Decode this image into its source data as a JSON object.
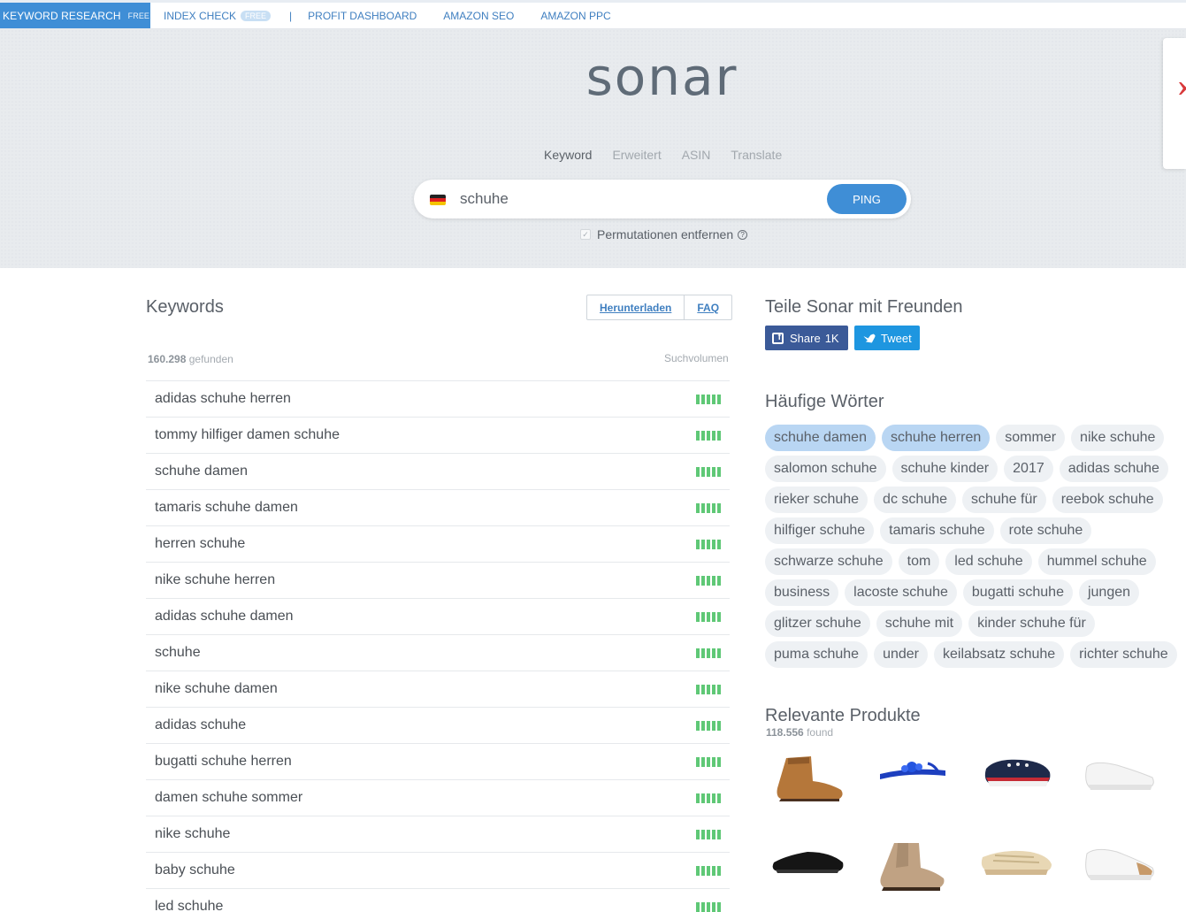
{
  "nav": {
    "active": {
      "label": "KEYWORD RESEARCH",
      "tag": "FREE"
    },
    "index_check": {
      "label": "INDEX CHECK",
      "tag": "FREE"
    },
    "separator": "|",
    "profit_dashboard": "PROFIT DASHBOARD",
    "amazon_seo": "AMAZON SEO",
    "amazon_ppc": "AMAZON PPC"
  },
  "hero": {
    "logo": "sonar",
    "modes": [
      "Keyword",
      "Erweitert",
      "ASIN",
      "Translate"
    ],
    "active_mode": "Keyword",
    "search_value": "schuhe",
    "ping_label": "PING",
    "permutations_label": "Permutationen entfernen",
    "permutations_checked": true
  },
  "keywords": {
    "title": "Keywords",
    "download_label": "Herunterladen",
    "faq_label": "FAQ",
    "found_count": "160.298",
    "found_label": "gefunden",
    "volume_label": "Suchvolumen",
    "rows": [
      "adidas schuhe herren",
      "tommy hilfiger damen schuhe",
      "schuhe damen",
      "tamaris schuhe damen",
      "herren schuhe",
      "nike schuhe herren",
      "adidas schuhe damen",
      "schuhe",
      "nike schuhe damen",
      "adidas schuhe",
      "bugatti schuhe herren",
      "damen schuhe sommer",
      "nike schuhe",
      "baby schuhe",
      "led schuhe"
    ]
  },
  "share": {
    "title": "Teile Sonar mit Freunden",
    "fb_label": "Share",
    "fb_count": "1K",
    "tw_label": "Tweet"
  },
  "words": {
    "title": "Häufige Wörter",
    "chips": [
      "schuhe damen",
      "schuhe herren",
      "sommer",
      "nike schuhe",
      "salomon schuhe",
      "schuhe kinder",
      "2017",
      "adidas schuhe",
      "rieker schuhe",
      "dc schuhe",
      "schuhe für",
      "reebok schuhe",
      "hilfiger schuhe",
      "tamaris schuhe",
      "rote schuhe",
      "schwarze schuhe",
      "tom",
      "led schuhe",
      "hummel schuhe",
      "business",
      "lacoste schuhe",
      "bugatti schuhe",
      "jungen",
      "glitzer schuhe",
      "schuhe mit",
      "kinder schuhe für",
      "puma schuhe",
      "under",
      "keilabsatz schuhe",
      "richter schuhe"
    ],
    "highlighted": [
      "schuhe damen",
      "schuhe herren"
    ]
  },
  "products": {
    "title": "Relevante Produkte",
    "found_count": "118.556",
    "found_label": "found"
  },
  "colors": {
    "accent": "#3f8ed6",
    "bars": "#5fc876",
    "fb": "#3b5a98",
    "twitter": "#1e96e0"
  }
}
